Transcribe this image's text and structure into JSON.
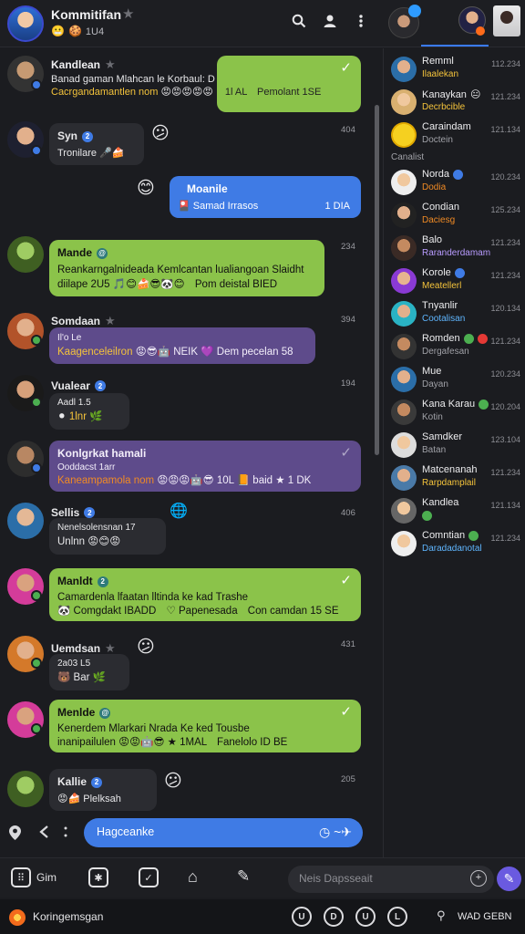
{
  "header": {
    "title": "Kommitifan",
    "subtitle_emojis": [
      "😬",
      "🍪"
    ],
    "subtitle": "1U4"
  },
  "messages": [
    {
      "name": "Kandlean",
      "line1": "Banad gaman Mlahcan le Korbaul: D",
      "line2": "Cacrgandamantlen nom",
      "emojis": "😡😡😡😡😡",
      "extra": "1l AL",
      "extra2": "Pemolant 1SE",
      "time": "",
      "style": "green-right"
    },
    {
      "name": "Syn",
      "line1": "Tronilare",
      "emojis": "🎤🍰",
      "time": "404",
      "style": "dark"
    },
    {
      "name": "Moanile",
      "line1": "Samad Irrasos",
      "extra": "1 DIA",
      "time": "",
      "style": "blue"
    },
    {
      "name": "Mande",
      "line1": "Reankarngalnideada Kemlcantan lualiangoan Slaidht",
      "line2": "diilape 2U5",
      "emojis": "🎵😊🍰😎🐼😊",
      "extra": "Pom deistal BIED",
      "time": "234",
      "style": "green"
    },
    {
      "name": "Somdaan",
      "line1": "Il'o Le",
      "line2": "Kaagenceleilron",
      "emojis": "😡😎🤖",
      "extra": "NEIK",
      "extra2": "Dem pecelan 58",
      "time": "394",
      "style": "purple"
    },
    {
      "name": "Vualear",
      "line1": "Aadl 1.5",
      "emojis": "⚫",
      "extra": "1lnr",
      "time": "194",
      "style": "dark"
    },
    {
      "name": "Konlgrkat hamali",
      "line1": "Ooddacst 1arr",
      "line2": "Kaneampamola nom",
      "emojis": "😡😡😡🤖😎",
      "extra": "10L",
      "extra2": "baid",
      "extra3": "1 DK",
      "time": "",
      "style": "purple"
    },
    {
      "name": "Sellis",
      "line1": "Nenelsolensnan 17",
      "line2": "Unlnn",
      "emojis": "😡😊😡",
      "time": "406",
      "style": "dark"
    },
    {
      "name": "Manldt",
      "line1": "Camardenla lfaatan lltinda ke kad Trashe",
      "line2": "Comgdakt IBADD",
      "extra": "Papenesada",
      "extra2": "Con camdan 15 SE",
      "time": "",
      "style": "green"
    },
    {
      "name": "Uemdsan",
      "line1": "2a03 L5",
      "emojis": "🐻",
      "extra": "Bar",
      "time": "431",
      "style": "dark"
    },
    {
      "name": "Menlde",
      "line1": "Kenerdem Mlarkari Nrada Ke ked Tousbe",
      "line2": "inanipailulen",
      "emojis": "😡😡🤖😎",
      "extra": "1MAL",
      "extra2": "Fanelolo ID BE",
      "time": "",
      "style": "green"
    },
    {
      "name": "Kallie",
      "line1": "Plelksah",
      "emojis": "😡🍰",
      "time": "205",
      "style": "dark"
    }
  ],
  "composer": {
    "placeholder": "Hagceanke"
  },
  "contacts": [
    {
      "name": "Remml",
      "sub": "Ilaalekan",
      "time": "112.234",
      "sub_color": "#f4c33b"
    },
    {
      "name": "Kanaykan",
      "sub": "Decrbcible",
      "time": "121.234",
      "sub_color": "#f4c33b"
    },
    {
      "name": "Caraindam",
      "sub": "Doctein",
      "time": "121.134",
      "sub_color": "#a0a1a7"
    },
    {
      "name": "Norda",
      "sub": "Dodia",
      "time": "120.234",
      "sub_color": "#f08a24"
    },
    {
      "name": "Condian",
      "sub": "Daciesg",
      "time": "125.234",
      "sub_color": "#f08a24"
    },
    {
      "name": "Balo",
      "sub": "Raranderdamam",
      "time": "121.234",
      "sub_color": "#b99cff"
    },
    {
      "name": "Korole",
      "sub": "Meatellerl",
      "time": "121.234",
      "sub_color": "#f4c33b"
    },
    {
      "name": "Tnyanlir",
      "sub": "Cootalisan",
      "time": "120.134",
      "sub_color": "#5fb6ff"
    },
    {
      "name": "Romden",
      "sub": "Dergafesan",
      "time": "121.234",
      "sub_color": "#a0a1a7"
    },
    {
      "name": "Mue",
      "sub": "Dayan",
      "time": "120.234",
      "sub_color": "#a0a1a7"
    },
    {
      "name": "Kana Karau",
      "sub": "Kotin",
      "time": "120.204",
      "sub_color": "#a0a1a7"
    },
    {
      "name": "Samdker",
      "sub": "Batan",
      "time": "123.104",
      "sub_color": "#a0a1a7"
    },
    {
      "name": "Matcenanah",
      "sub": "Rarpdamplail",
      "time": "121.234",
      "sub_color": "#f4c33b"
    },
    {
      "name": "Kandlea",
      "sub": "",
      "time": "121.134",
      "sub_color": "#a0a1a7"
    },
    {
      "name": "Comntian",
      "sub": "Daradadanotal",
      "time": "121.234",
      "sub_color": "#5fb6ff"
    }
  ],
  "right_section_label": "Canalist",
  "toolbar": {
    "items": [
      "Gim"
    ],
    "search_placeholder": "Neis Dapsseait"
  },
  "statusbar": {
    "label": "Koringemsgan",
    "icons": [
      "U",
      "D",
      "U",
      "L"
    ],
    "right": "WAD GEBN"
  }
}
